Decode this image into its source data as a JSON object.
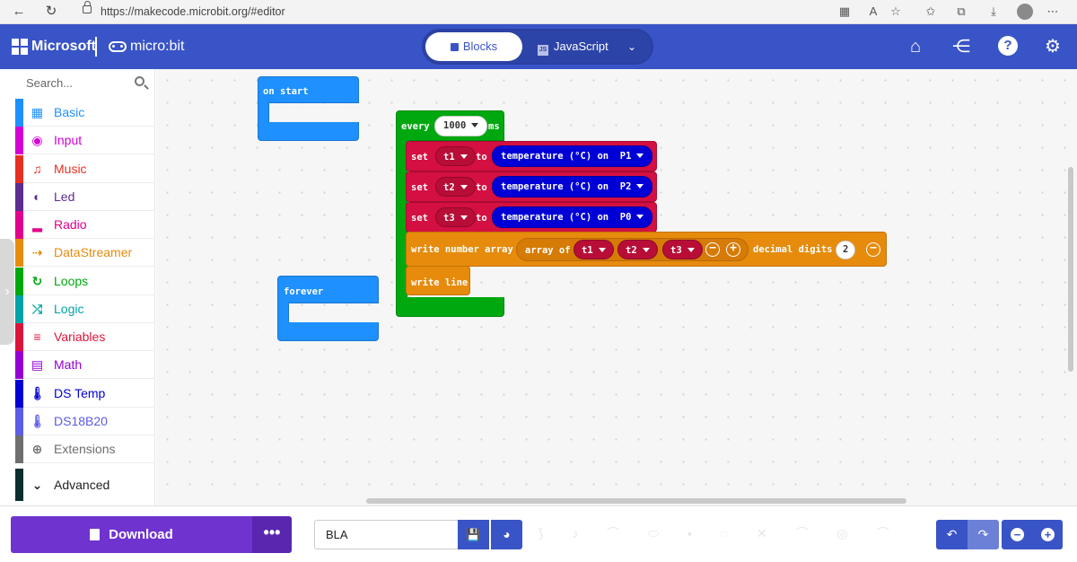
{
  "browser": {
    "url": "https://makecode.microbit.org/#editor",
    "back_glyph": "←",
    "reload_glyph": "↻"
  },
  "header": {
    "brand": "Microsoft",
    "product": "micro:bit",
    "editor_modes": {
      "blocks": "Blocks",
      "javascript": "JavaScript",
      "js_badge": "JS"
    },
    "icons": [
      "home-icon",
      "share-icon",
      "help-icon",
      "settings-icon"
    ],
    "help_glyph": "?"
  },
  "toolbox": {
    "search_placeholder": "Search...",
    "categories": [
      {
        "label": "Basic",
        "color": "#1e90ff",
        "icon": "grid-icon",
        "glyph": "▦"
      },
      {
        "label": "Input",
        "color": "#d400d4",
        "icon": "circle-dot-icon",
        "glyph": "◉"
      },
      {
        "label": "Music",
        "color": "#e63022",
        "icon": "headphones-icon",
        "glyph": "♫"
      },
      {
        "label": "Led",
        "color": "#5c2d91",
        "icon": "toggle-icon",
        "glyph": "◐"
      },
      {
        "label": "Radio",
        "color": "#e3008c",
        "icon": "signal-bars-icon",
        "glyph": "▂"
      },
      {
        "label": "DataStreamer",
        "color": "#e68b0c",
        "icon": "usb-icon",
        "glyph": "⇢"
      },
      {
        "label": "Loops",
        "color": "#00a80f",
        "icon": "loop-icon",
        "glyph": "↻"
      },
      {
        "label": "Logic",
        "color": "#00a4a6",
        "icon": "shuffle-icon",
        "glyph": "⤮"
      },
      {
        "label": "Variables",
        "color": "#dc143c",
        "icon": "list-icon",
        "glyph": "≡"
      },
      {
        "label": "Math",
        "color": "#9400d3",
        "icon": "calculator-icon",
        "glyph": "▤"
      },
      {
        "label": "DS Temp",
        "color": "#0000d6",
        "icon": "thermometer-icon",
        "glyph": "🌡"
      },
      {
        "label": "DS18B20",
        "color": "#5c5ce6",
        "icon": "thermometer-icon",
        "glyph": "🌡"
      },
      {
        "label": "Extensions",
        "color": "#6e6e6e",
        "icon": "plus-circle-icon",
        "glyph": "⊕"
      },
      {
        "label": "Advanced",
        "color": "#0b2e2e",
        "icon": "chevron-down-icon",
        "glyph": "⌄"
      }
    ],
    "collapse_glyph": "›"
  },
  "workspace": {
    "on_start": {
      "label": "on start"
    },
    "forever": {
      "label": "forever"
    },
    "every": {
      "label": "every",
      "interval": "1000",
      "unit": "ms",
      "sets": [
        {
          "kw": "set",
          "var": "t1",
          "to": "to",
          "sensor": "temperature (°C) on",
          "pin": "P1"
        },
        {
          "kw": "set",
          "var": "t2",
          "to": "to",
          "sensor": "temperature (°C) on",
          "pin": "P2"
        },
        {
          "kw": "set",
          "var": "t3",
          "to": "to",
          "sensor": "temperature (°C) on",
          "pin": "P0"
        }
      ],
      "write_array": {
        "label": "write number array",
        "array_label": "array of",
        "items": [
          "t1",
          "t2",
          "t3"
        ],
        "decimal_label": "decimal digits",
        "decimal_value": "2",
        "minus_glyph": "−",
        "plus_glyph": "+"
      },
      "write_line": {
        "label": "write line"
      }
    }
  },
  "bottom": {
    "download_label": "Download",
    "more_glyph": "•••",
    "project_name": "BLA",
    "save_glyph": "💾",
    "github_glyph": "◕",
    "undo_glyph": "↶",
    "redo_glyph": "↷",
    "zoom_out_glyph": "−",
    "zoom_in_glyph": "+"
  }
}
